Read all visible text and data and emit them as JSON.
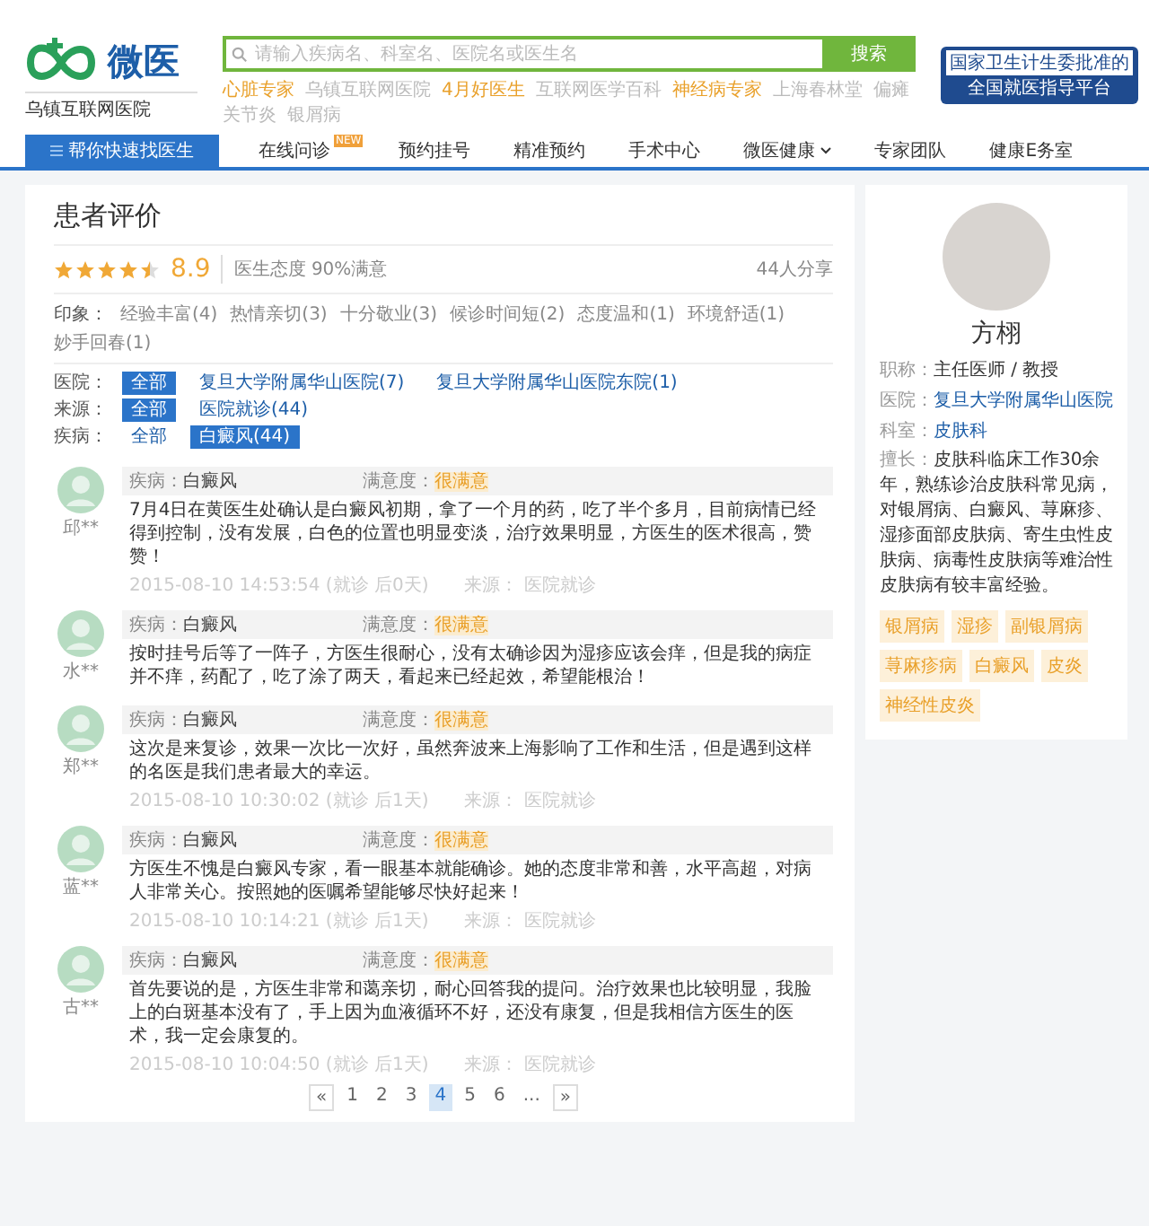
{
  "header": {
    "logo": {
      "name": "微医",
      "subtitle": "乌镇互联网医院"
    },
    "search": {
      "placeholder": "请输入疾病名、科室名、医院名或医生名",
      "button": "搜索"
    },
    "hot_words": [
      {
        "text": "心脏专家",
        "highlight": true
      },
      {
        "text": "乌镇互联网医院",
        "highlight": false
      },
      {
        "text": "4月好医生",
        "highlight": true
      },
      {
        "text": "互联网医学百科",
        "highlight": false
      },
      {
        "text": "神经病专家",
        "highlight": true
      },
      {
        "text": "上海春林堂",
        "highlight": false
      },
      {
        "text": "偏瘫",
        "highlight": false
      },
      {
        "text": "关节炎",
        "highlight": false
      },
      {
        "text": "银屑病",
        "highlight": false
      }
    ],
    "badge": {
      "line1": "国家卫生计生委批准的",
      "line2": "全国就医指导平台"
    }
  },
  "nav": [
    {
      "label": "帮你快速找医生",
      "kind": "primary",
      "selected": true
    },
    {
      "label": "在线问诊",
      "kind": "new",
      "badge": "NEW",
      "selected": false
    },
    {
      "label": "预约挂号",
      "kind": "plain",
      "selected": false
    },
    {
      "label": "精准预约",
      "kind": "plain",
      "selected": false
    },
    {
      "label": "手术中心",
      "kind": "plain",
      "selected": false
    },
    {
      "label": "微医健康",
      "kind": "dropdown",
      "selected": false
    },
    {
      "label": "专家团队",
      "kind": "plain",
      "selected": false
    },
    {
      "label": "健康E务室",
      "kind": "plain",
      "selected": false
    }
  ],
  "reviews_panel": {
    "title": "患者评价",
    "stars": 4.5,
    "score": "8.9",
    "attitude": "医生态度 90%满意",
    "shares": "44人分享",
    "impressions": {
      "label": "印象：",
      "tags": [
        "经验丰富(4)",
        "热情亲切(3)",
        "十分敬业(3)",
        "候诊时间短(2)",
        "态度温和(1)",
        "环境舒适(1)",
        "妙手回春(1)"
      ]
    },
    "filters": [
      {
        "label": "医院：",
        "options": [
          {
            "text": "全部",
            "selected": true
          },
          {
            "text": "复旦大学附属华山医院(7)",
            "selected": false
          },
          {
            "text": "复旦大学附属华山医院东院(1)",
            "selected": false
          }
        ]
      },
      {
        "label": "来源：",
        "options": [
          {
            "text": "全部",
            "selected": true
          },
          {
            "text": "医院就诊(44)",
            "selected": false
          }
        ]
      },
      {
        "label": "疾病：",
        "options": [
          {
            "text": "全部",
            "selected": false
          },
          {
            "text": "白癜风(44)",
            "selected": true
          }
        ]
      }
    ],
    "reviews": [
      {
        "user": "邱**",
        "disease_label": "疾病：",
        "disease": "白癜风",
        "satisfaction_label": "满意度：",
        "satisfaction": "很满意",
        "text": "7月4日在黄医生处确认是白癜风初期，拿了一个月的药，吃了半个多月，目前病情已经得到控制，没有发展，白色的位置也明显变淡，治疗效果明显，方医生的医术很高，赞赞！",
        "time": "2015-08-10 14:53:54 (就诊 后0天)",
        "source": "来源： 医院就诊"
      },
      {
        "user": "水**",
        "disease_label": "疾病：",
        "disease": "白癜风",
        "satisfaction_label": "满意度：",
        "satisfaction": "很满意",
        "text": "按时挂号后等了一阵子，方医生很耐心，没有太确诊因为湿疹应该会痒，但是我的病症并不痒，药配了，吃了涂了两天，看起来已经起效，希望能根治！"
      },
      {
        "user": "郑**",
        "disease_label": "疾病：",
        "disease": "白癜风",
        "satisfaction_label": "满意度：",
        "satisfaction": "很满意",
        "text": "这次是来复诊，效果一次比一次好，虽然奔波来上海影响了工作和生活，但是遇到这样的名医是我们患者最大的幸运。",
        "time": "2015-08-10 10:30:02 (就诊 后1天)",
        "source": "来源： 医院就诊"
      },
      {
        "user": "蓝**",
        "disease_label": "疾病：",
        "disease": "白癜风",
        "satisfaction_label": "满意度：",
        "satisfaction": "很满意",
        "text": "方医生不愧是白癜风专家，看一眼基本就能确诊。她的态度非常和善，水平高超，对病人非常关心。按照她的医嘱希望能够尽快好起来！",
        "time": "2015-08-10 10:14:21 (就诊 后1天)",
        "source": "来源： 医院就诊"
      },
      {
        "user": "古**",
        "disease_label": "疾病：",
        "disease": "白癜风",
        "satisfaction_label": "满意度：",
        "satisfaction": "很满意",
        "text": "首先要说的是，方医生非常和蔼亲切，耐心回答我的提问。治疗效果也比较明显，我脸上的白斑基本没有了，手上因为血液循环不好，还没有康复，但是我相信方医生的医术，我一定会康复的。",
        "time": "2015-08-10 10:04:50 (就诊 后1天)",
        "source": "来源： 医院就诊"
      }
    ],
    "pagination": [
      {
        "text": "«",
        "kind": "arrow",
        "selected": false
      },
      {
        "text": "1",
        "kind": "page",
        "selected": false
      },
      {
        "text": "2",
        "kind": "page",
        "selected": false
      },
      {
        "text": "3",
        "kind": "page",
        "selected": false
      },
      {
        "text": "4",
        "kind": "page",
        "selected": true
      },
      {
        "text": "5",
        "kind": "page",
        "selected": false
      },
      {
        "text": "6",
        "kind": "page",
        "selected": false
      },
      {
        "text": "...",
        "kind": "gap",
        "selected": false
      },
      {
        "text": "»",
        "kind": "arrow",
        "selected": false
      }
    ]
  },
  "doctor": {
    "name": "方栩",
    "fields": [
      {
        "label": "职称：",
        "value": "主任医师 / 教授",
        "link": false
      },
      {
        "label": "医院：",
        "value": "复旦大学附属华山医院",
        "link": true
      },
      {
        "label": "科室：",
        "value": "皮肤科",
        "link": true
      }
    ],
    "specialty_label": "擅长：",
    "specialty": "皮肤科临床工作30余年，熟练诊治皮肤科常见病，对银屑病、白癜风、荨麻疹、湿疹面部皮肤病、寄生虫性皮肤病、病毒性皮肤病等难治性皮肤病有较丰富经验。",
    "tags": [
      "银屑病",
      "湿疹",
      "副银屑病",
      "荨麻疹病",
      "白癜风",
      "皮炎",
      "神经性皮炎"
    ]
  }
}
